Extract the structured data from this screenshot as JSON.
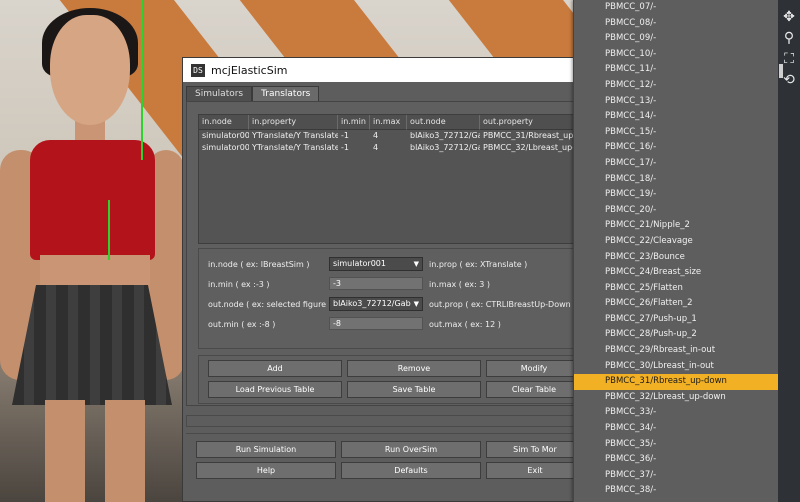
{
  "window": {
    "title": "mcjElasticSim",
    "icon_text": "DS"
  },
  "tabs": [
    {
      "label": "Simulators",
      "active": false
    },
    {
      "label": "Translators",
      "active": true
    }
  ],
  "table": {
    "headers": [
      "in.node",
      "in.property",
      "in.min",
      "in.max",
      "out.node",
      "out.property"
    ],
    "rows": [
      [
        "simulator001",
        "YTranslate/Y Translate",
        "-1",
        "4",
        "blAiko3_72712/Gab",
        "PBMCC_31/Rbreast_up-"
      ],
      [
        "simulator001",
        "YTranslate/Y Translate",
        "-1",
        "4",
        "blAiko3_72712/Gab",
        "PBMCC_32/Lbreast_up-"
      ]
    ]
  },
  "form": {
    "in_node_label": "in.node ( ex: lBreastSim )",
    "in_node_value": "simulator001",
    "in_prop_label": "in.prop ( ex: XTranslate )",
    "in_min_label": "in.min ( ex :-3 )",
    "in_min_value": "-3",
    "in_max_label": "in.max ( ex: 3 )",
    "out_node_label": "out.node ( ex: selected figure )",
    "out_node_value": "blAiko3_72712/Gab",
    "out_prop_label": "out.prop ( ex: CTRLlBreastUp-Down )",
    "out_min_label": "out.min ( ex :-8 )",
    "out_min_value": "-8",
    "out_max_label": "out.max ( ex: 12 )"
  },
  "buttons": {
    "add": "Add",
    "remove": "Remove",
    "modify": "Modify",
    "load_previous": "Load Previous Table",
    "save_table": "Save Table",
    "clear_table": "Clear Table",
    "run_simulation": "Run Simulation",
    "run_oversim": "Run OverSim",
    "sim_to_more": "Sim To Mor",
    "help": "Help",
    "defaults": "Defaults",
    "exit": "Exit"
  },
  "dropdown": {
    "items": [
      "PBMCC_07/-",
      "PBMCC_08/-",
      "PBMCC_09/-",
      "PBMCC_10/-",
      "PBMCC_11/-",
      "PBMCC_12/-",
      "PBMCC_13/-",
      "PBMCC_14/-",
      "PBMCC_15/-",
      "PBMCC_16/-",
      "PBMCC_17/-",
      "PBMCC_18/-",
      "PBMCC_19/-",
      "PBMCC_20/-",
      "PBMCC_21/Nipple_2",
      "PBMCC_22/Cleavage",
      "PBMCC_23/Bounce",
      "PBMCC_24/Breast_size",
      "PBMCC_25/Flatten",
      "PBMCC_26/Flatten_2",
      "PBMCC_27/Push-up_1",
      "PBMCC_28/Push-up_2",
      "PBMCC_29/Rbreast_in-out",
      "PBMCC_30/Lbreast_in-out",
      "PBMCC_31/Rbreast_up-down",
      "PBMCC_32/Lbreast_up-down",
      "PBMCC_33/-",
      "PBMCC_34/-",
      "PBMCC_35/-",
      "PBMCC_36/-",
      "PBMCC_37/-",
      "PBMCC_38/-"
    ],
    "selected_index": 24,
    "highlight_color": "#f2b125"
  },
  "side_tools": [
    "move-icon",
    "zoom-icon",
    "frame-icon",
    "rotate-icon"
  ]
}
